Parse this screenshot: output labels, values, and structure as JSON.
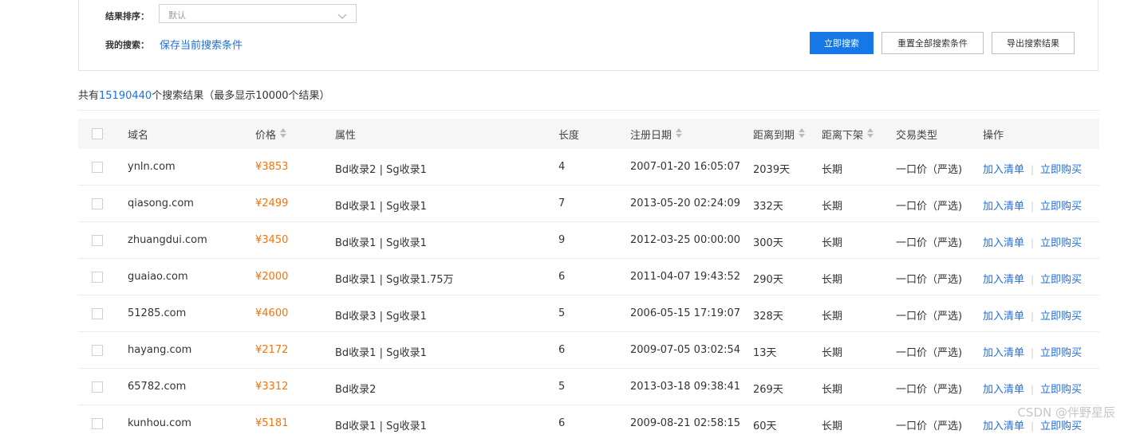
{
  "filters": {
    "sort_label": "结果排序：",
    "sort_value": "默认",
    "my_search_label": "我的搜索：",
    "save_link": "保存当前搜索条件"
  },
  "buttons": {
    "search": "立即搜索",
    "reset": "重置全部搜索条件",
    "export": "导出搜索结果"
  },
  "summary": {
    "prefix": "共有",
    "count": "15190440",
    "suffix": "个搜索结果（最多显示10000个结果）"
  },
  "table": {
    "headers": {
      "domain": "域名",
      "price": "价格",
      "attrs": "属性",
      "length": "长度",
      "reg_date": "注册日期",
      "expiry": "距离到期",
      "delist": "距离下架",
      "trade_type": "交易类型",
      "ops": "操作"
    },
    "rows": [
      {
        "domain": "ynln.com",
        "price": "¥3853",
        "attrs": "Bd收录2 | Sg收录1",
        "length": "4",
        "reg_date": "2007-01-20 16:05:07",
        "expiry": "2039天",
        "delist": "长期",
        "trade_type": "一口价（严选)",
        "add": "加入清单",
        "buy": "立即购买"
      },
      {
        "domain": "qiasong.com",
        "price": "¥2499",
        "attrs": "Bd收录1 | Sg收录1",
        "length": "7",
        "reg_date": "2013-05-20 02:24:09",
        "expiry": "332天",
        "delist": "长期",
        "trade_type": "一口价（严选)",
        "add": "加入清单",
        "buy": "立即购买"
      },
      {
        "domain": "zhuangdui.com",
        "price": "¥3450",
        "attrs": "Bd收录1 | Sg收录1",
        "length": "9",
        "reg_date": "2012-03-25 00:00:00",
        "expiry": "300天",
        "delist": "长期",
        "trade_type": "一口价（严选)",
        "add": "加入清单",
        "buy": "立即购买"
      },
      {
        "domain": "guaiao.com",
        "price": "¥2000",
        "attrs": "Bd收录1 | Sg收录1.75万",
        "length": "6",
        "reg_date": "2011-04-07 19:43:52",
        "expiry": "290天",
        "delist": "长期",
        "trade_type": "一口价（严选)",
        "add": "加入清单",
        "buy": "立即购买"
      },
      {
        "domain": "51285.com",
        "price": "¥4600",
        "attrs": "Bd收录3 | Sg收录1",
        "length": "5",
        "reg_date": "2006-05-15 17:19:07",
        "expiry": "328天",
        "delist": "长期",
        "trade_type": "一口价（严选)",
        "add": "加入清单",
        "buy": "立即购买"
      },
      {
        "domain": "hayang.com",
        "price": "¥2172",
        "attrs": "Bd收录1 | Sg收录1",
        "length": "6",
        "reg_date": "2009-07-05 03:02:54",
        "expiry": "13天",
        "delist": "长期",
        "trade_type": "一口价（严选)",
        "add": "加入清单",
        "buy": "立即购买"
      },
      {
        "domain": "65782.com",
        "price": "¥3312",
        "attrs": "Bd收录2",
        "length": "5",
        "reg_date": "2013-03-18 09:38:41",
        "expiry": "269天",
        "delist": "长期",
        "trade_type": "一口价（严选)",
        "add": "加入清单",
        "buy": "立即购买"
      },
      {
        "domain": "kunhou.com",
        "price": "¥5181",
        "attrs": "Bd收录1 | Sg收录1",
        "length": "6",
        "reg_date": "2009-08-21 02:58:15",
        "expiry": "60天",
        "delist": "长期",
        "trade_type": "一口价（严选)",
        "add": "加入清单",
        "buy": "立即购买"
      }
    ]
  },
  "watermark": "CSDN @伴野星辰",
  "colors": {
    "accent": "#1f6fde",
    "primary_button": "#1677e6",
    "price": "#f5730a"
  },
  "icons": {
    "select": "chevron-down-icon",
    "sort": "sort-icon"
  }
}
